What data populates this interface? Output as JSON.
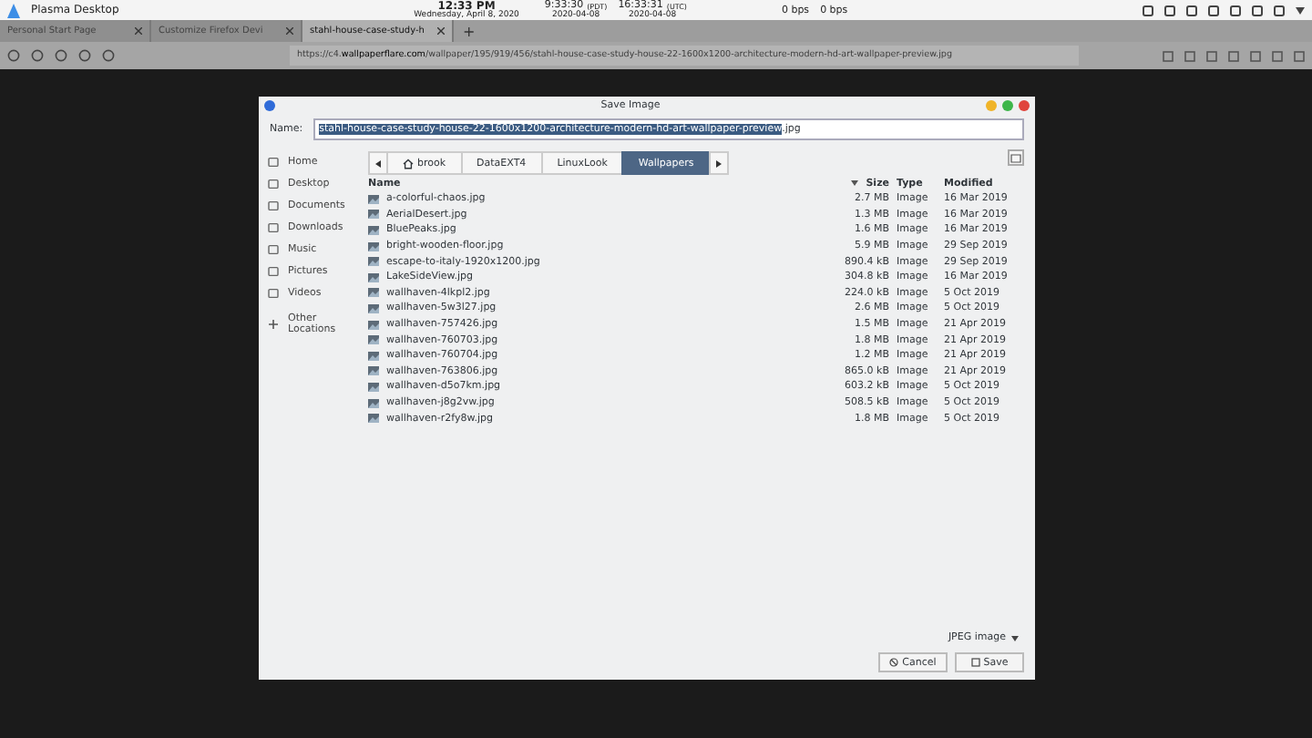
{
  "panel": {
    "title": "Plasma Desktop",
    "clock": {
      "time": "12:33 PM",
      "date": "Wednesday, April 8, 2020"
    },
    "clocks": [
      {
        "time": "9:33:30",
        "zone": "(PDT)",
        "date": "2020-04-08"
      },
      {
        "time": "16:33:31",
        "zone": "(UTC)",
        "date": "2020-04-08"
      }
    ],
    "net": [
      "0 bps",
      "0 bps"
    ]
  },
  "browser": {
    "tabs": [
      {
        "label": "Personal Start Page",
        "selected": false
      },
      {
        "label": "Customize Firefox Devi",
        "selected": false
      },
      {
        "label": "stahl-house-case-study-h",
        "selected": true
      }
    ],
    "new_tab": "+",
    "url_prefix": "https://c4.",
    "url_host": "wallpaperflare.com",
    "url_path": "/wallpaper/195/919/456/stahl-house-case-study-house-22-1600x1200-architecture-modern-hd-art-wallpaper-preview.jpg"
  },
  "dialog": {
    "title": "Save Image",
    "name_label": "Name:",
    "name_selected": "stahl-house-case-study-house-22-1600x1200-architecture-modern-hd-art-wallpaper-preview",
    "name_rest": ".jpg",
    "places": [
      {
        "label": "Home"
      },
      {
        "label": "Desktop"
      },
      {
        "label": "Documents"
      },
      {
        "label": "Downloads"
      },
      {
        "label": "Music"
      },
      {
        "label": "Pictures"
      },
      {
        "label": "Videos"
      },
      {
        "label": "Other Locations"
      }
    ],
    "path": [
      {
        "label": "brook",
        "selected": false
      },
      {
        "label": "DataEXT4",
        "selected": false
      },
      {
        "label": "LinuxLook",
        "selected": false
      },
      {
        "label": "Wallpapers",
        "selected": true
      }
    ],
    "columns": [
      "Name",
      "Size",
      "Type",
      "Modified"
    ],
    "files": [
      {
        "name": "a-colorful-chaos.jpg",
        "size": "2.7 MB",
        "type": "Image",
        "modified": "16 Mar 2019"
      },
      {
        "name": "AerialDesert.jpg",
        "size": "1.3 MB",
        "type": "Image",
        "modified": "16 Mar 2019"
      },
      {
        "name": "BluePeaks.jpg",
        "size": "1.6 MB",
        "type": "Image",
        "modified": "16 Mar 2019"
      },
      {
        "name": "bright-wooden-floor.jpg",
        "size": "5.9 MB",
        "type": "Image",
        "modified": "29 Sep 2019"
      },
      {
        "name": "escape-to-italy-1920x1200.jpg",
        "size": "890.4 kB",
        "type": "Image",
        "modified": "29 Sep 2019"
      },
      {
        "name": "LakeSideView.jpg",
        "size": "304.8 kB",
        "type": "Image",
        "modified": "16 Mar 2019"
      },
      {
        "name": "wallhaven-4lkpl2.jpg",
        "size": "224.0 kB",
        "type": "Image",
        "modified": "5 Oct 2019"
      },
      {
        "name": "wallhaven-5w3l27.jpg",
        "size": "2.6 MB",
        "type": "Image",
        "modified": "5 Oct 2019"
      },
      {
        "name": "wallhaven-757426.jpg",
        "size": "1.5 MB",
        "type": "Image",
        "modified": "21 Apr 2019"
      },
      {
        "name": "wallhaven-760703.jpg",
        "size": "1.8 MB",
        "type": "Image",
        "modified": "21 Apr 2019"
      },
      {
        "name": "wallhaven-760704.jpg",
        "size": "1.2 MB",
        "type": "Image",
        "modified": "21 Apr 2019"
      },
      {
        "name": "wallhaven-763806.jpg",
        "size": "865.0 kB",
        "type": "Image",
        "modified": "21 Apr 2019"
      },
      {
        "name": "wallhaven-d5o7km.jpg",
        "size": "603.2 kB",
        "type": "Image",
        "modified": "5 Oct 2019"
      },
      {
        "name": "wallhaven-j8g2vw.jpg",
        "size": "508.5 kB",
        "type": "Image",
        "modified": "5 Oct 2019"
      },
      {
        "name": "wallhaven-r2fy8w.jpg",
        "size": "1.8 MB",
        "type": "Image",
        "modified": "5 Oct 2019"
      }
    ],
    "filter": "JPEG image",
    "buttons": [
      "Cancel",
      "Save"
    ]
  }
}
